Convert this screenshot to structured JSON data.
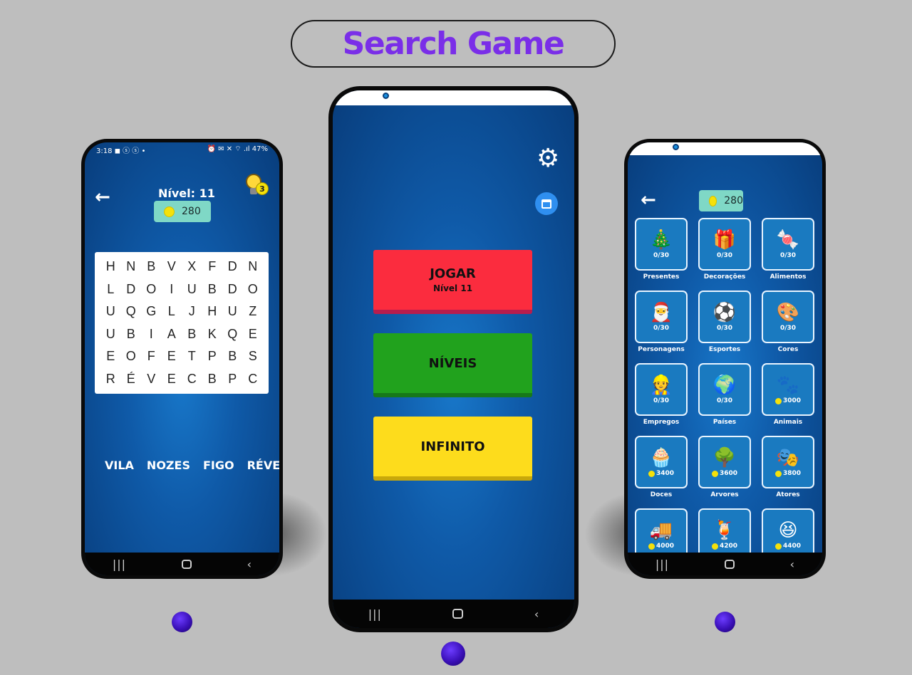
{
  "banner": {
    "title": "Search Game"
  },
  "left_phone": {
    "status_left": "3:18 ◼ ⓢ ⓢ •",
    "status_right": "⏰ ✉ ✕ ⌔ .ıl 47%",
    "level_title": "Nível: 11",
    "coins": "280",
    "hints": "3",
    "grid": [
      [
        "H",
        "N",
        "B",
        "V",
        "X",
        "F",
        "D",
        "N"
      ],
      [
        "L",
        "D",
        "O",
        "I",
        "U",
        "B",
        "D",
        "O"
      ],
      [
        "U",
        "Q",
        "G",
        "L",
        "J",
        "H",
        "U",
        "Z"
      ],
      [
        "U",
        "B",
        "I",
        "A",
        "B",
        "K",
        "Q",
        "E"
      ],
      [
        "E",
        "O",
        "F",
        "E",
        "T",
        "P",
        "B",
        "S"
      ],
      [
        "R",
        "É",
        "V",
        "E",
        "C",
        "B",
        "P",
        "C"
      ]
    ],
    "words": [
      "VILA",
      "NOZES",
      "FIGO",
      "RÉVE"
    ]
  },
  "center_phone": {
    "buttons": [
      {
        "label": "JOGAR",
        "sub": "Nível 11",
        "color": "#fb2c3e"
      },
      {
        "label": "NÍVEIS",
        "sub": "",
        "color": "#21a21d"
      },
      {
        "label": "INFINITO",
        "sub": "",
        "color": "#fddc1c"
      }
    ]
  },
  "right_phone": {
    "coins": "280",
    "categories": [
      {
        "name": "Presentes",
        "count": "0/30",
        "icon": "christmas-tree-icon",
        "glyph": "🎄"
      },
      {
        "name": "Decorações",
        "count": "0/30",
        "icon": "gift-boxes-icon",
        "glyph": "🎁"
      },
      {
        "name": "Alimentos",
        "count": "0/30",
        "icon": "candy-cane-icon",
        "glyph": "🍬"
      },
      {
        "name": "Personagens",
        "count": "0/30",
        "icon": "santa-icon",
        "glyph": "🎅"
      },
      {
        "name": "Esportes",
        "count": "0/30",
        "icon": "sports-balls-icon",
        "glyph": "⚽"
      },
      {
        "name": "Cores",
        "count": "0/30",
        "icon": "palette-icon",
        "glyph": "🎨"
      },
      {
        "name": "Empregos",
        "count": "0/30",
        "icon": "worker-icon",
        "glyph": "👷"
      },
      {
        "name": "Países",
        "count": "0/30",
        "icon": "globe-icon",
        "glyph": "🌍"
      },
      {
        "name": "Animais",
        "count": "3000",
        "icon": "paw-icon",
        "glyph": "🐾",
        "priced": true
      },
      {
        "name": "Doces",
        "count": "3400",
        "icon": "cupcake-icon",
        "glyph": "🧁",
        "priced": true
      },
      {
        "name": "Arvores",
        "count": "3600",
        "icon": "tree-icon",
        "glyph": "🌳",
        "priced": true
      },
      {
        "name": "Atores",
        "count": "3800",
        "icon": "actor-icon",
        "glyph": "🎭",
        "priced": true
      },
      {
        "name": "",
        "count": "4000",
        "icon": "delivery-truck-icon",
        "glyph": "🚚",
        "priced": true
      },
      {
        "name": "",
        "count": "4200",
        "icon": "drink-icon",
        "glyph": "🍹",
        "priced": true
      },
      {
        "name": "",
        "count": "4400",
        "icon": "faces-icon",
        "glyph": "😆",
        "priced": true
      }
    ]
  },
  "colors": {
    "accent": "#7a2ee8",
    "screen_blue": "#0f5aa8",
    "coin": "#f5e10a",
    "dot": "#3a10b8"
  }
}
